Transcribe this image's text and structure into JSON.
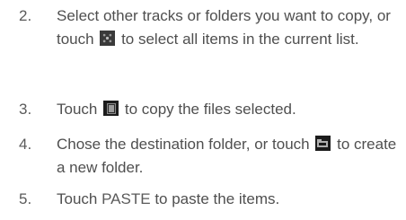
{
  "steps": [
    {
      "number": "2.",
      "text_before": "Select other tracks or folders you want to copy, or touch",
      "icon": "select-all-icon",
      "text_after": "to select all items in the current list."
    },
    {
      "number": "3.",
      "text_before": "Touch",
      "icon": "copy-icon",
      "text_after": "to copy the files selected."
    },
    {
      "number": "4.",
      "text_before": "Chose the destination folder, or touch",
      "icon": "new-folder-icon",
      "text_after": "to create a new folder."
    },
    {
      "number": "5.",
      "text_before": "Touch",
      "keyword": "PASTE",
      "text_after": "to paste the items."
    }
  ]
}
